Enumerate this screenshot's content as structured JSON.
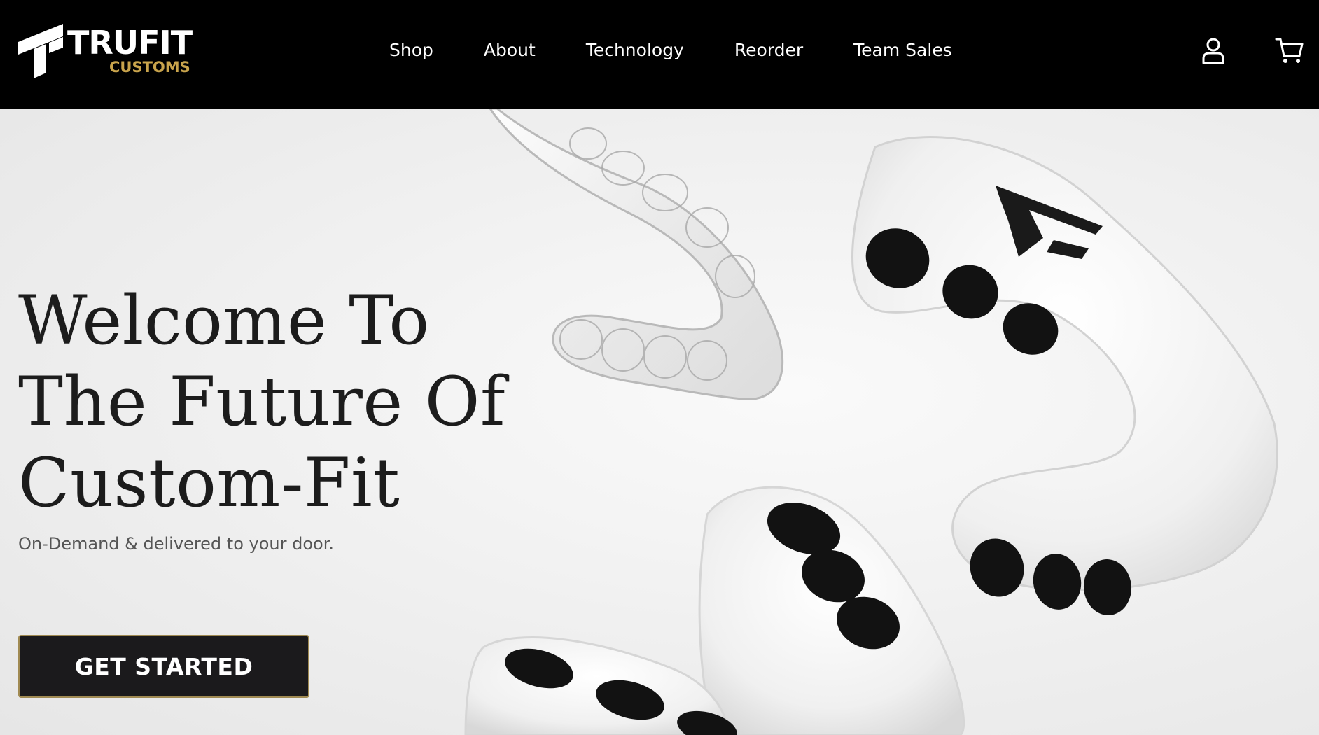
{
  "brand": {
    "name": "TRUFIT",
    "sub": "CUSTOMS",
    "accent_color": "#c9a44c"
  },
  "nav": {
    "items": [
      {
        "label": "Shop"
      },
      {
        "label": "About"
      },
      {
        "label": "Technology"
      },
      {
        "label": "Reorder"
      },
      {
        "label": "Team Sales"
      }
    ],
    "account_icon": "user-icon",
    "cart_icon": "cart-icon"
  },
  "hero": {
    "title_line1": "Welcome To",
    "title_line2": "The Future Of",
    "title_line3": "Custom-Fit",
    "subtitle": "On-Demand & delivered to your door.",
    "cta_label": "GET STARTED",
    "image": "mouthguards-product-image"
  }
}
